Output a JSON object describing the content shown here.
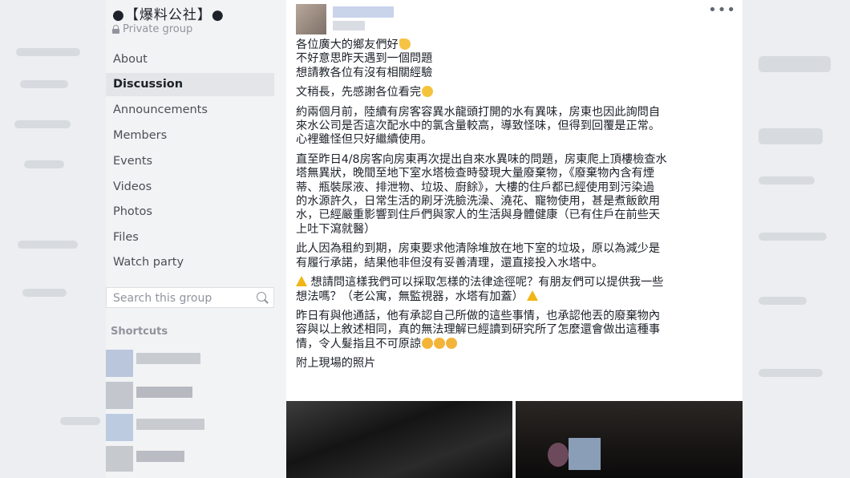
{
  "group": {
    "title": "●【爆料公社】●",
    "privacy": "Private group"
  },
  "nav": [
    {
      "label": "About"
    },
    {
      "label": "Discussion"
    },
    {
      "label": "Announcements"
    },
    {
      "label": "Members"
    },
    {
      "label": "Events"
    },
    {
      "label": "Videos"
    },
    {
      "label": "Photos"
    },
    {
      "label": "Files"
    },
    {
      "label": "Watch party"
    }
  ],
  "search": {
    "placeholder": "Search this group"
  },
  "shortcuts": {
    "title": "Shortcuts"
  },
  "post": {
    "more": "•••",
    "paragraphs": [
      [
        "各位廣大的鄉友們好",
        "不好意思昨天遇到一個問題",
        "想請教各位有沒有相關經驗"
      ],
      [
        "文稍長，先感謝各位看完"
      ],
      [
        "約兩個月前，陸續有房客容異水龍頭打開的水有異味，房東也因此詢問自",
        "來水公司是否這次配水中的氯含量較高，導致怪味，但得到回覆是正常。",
        "心裡雖怪但只好繼續使用。"
      ],
      [
        "直至昨日4/8房客向房東再次提出自來水異味的問題，房東爬上頂樓檢查水",
        "塔無異狀，晚間至地下室水塔檢查時發現大量廢棄物，《廢棄物內含有煙",
        "蒂、瓶裝尿液、排泄物、垃圾、廚餘》，大樓的住戶都已經使用到污染過",
        "的水源許久，日常生活的刷牙洗臉洗澡、澆花、寵物使用，甚是煮飯飲用",
        "水，已經嚴重影響到住戶們與家人的生活與身體健康（已有住戶在前些天",
        "上吐下瀉就醫）"
      ],
      [
        "此人因為租約到期，房東要求他清除堆放在地下室的垃圾，原以為減少是",
        "有履行承諾，結果他非但沒有妥善清理，還直接投入水塔中。"
      ],
      [
        "想請問這樣我們可以採取怎樣的法律途徑呢？有朋友們可以提供我一些",
        "想法嗎？（老公寓，無監視器，水塔有加蓋）"
      ],
      [
        "昨日有與他通話，他有承認自己所做的這些事情，也承認他丟的廢棄物內",
        "容與以上敘述相同，真的無法理解已經讀到研究所了怎麼還會做出這種事",
        "情，令人髮指且不可原諒"
      ],
      [
        "附上現場的照片"
      ]
    ]
  },
  "colors": {
    "sidebar_bg": "#f2f3f5",
    "active_bg": "#e3e5e8",
    "text": "#1d2129",
    "muted": "#90949c"
  }
}
